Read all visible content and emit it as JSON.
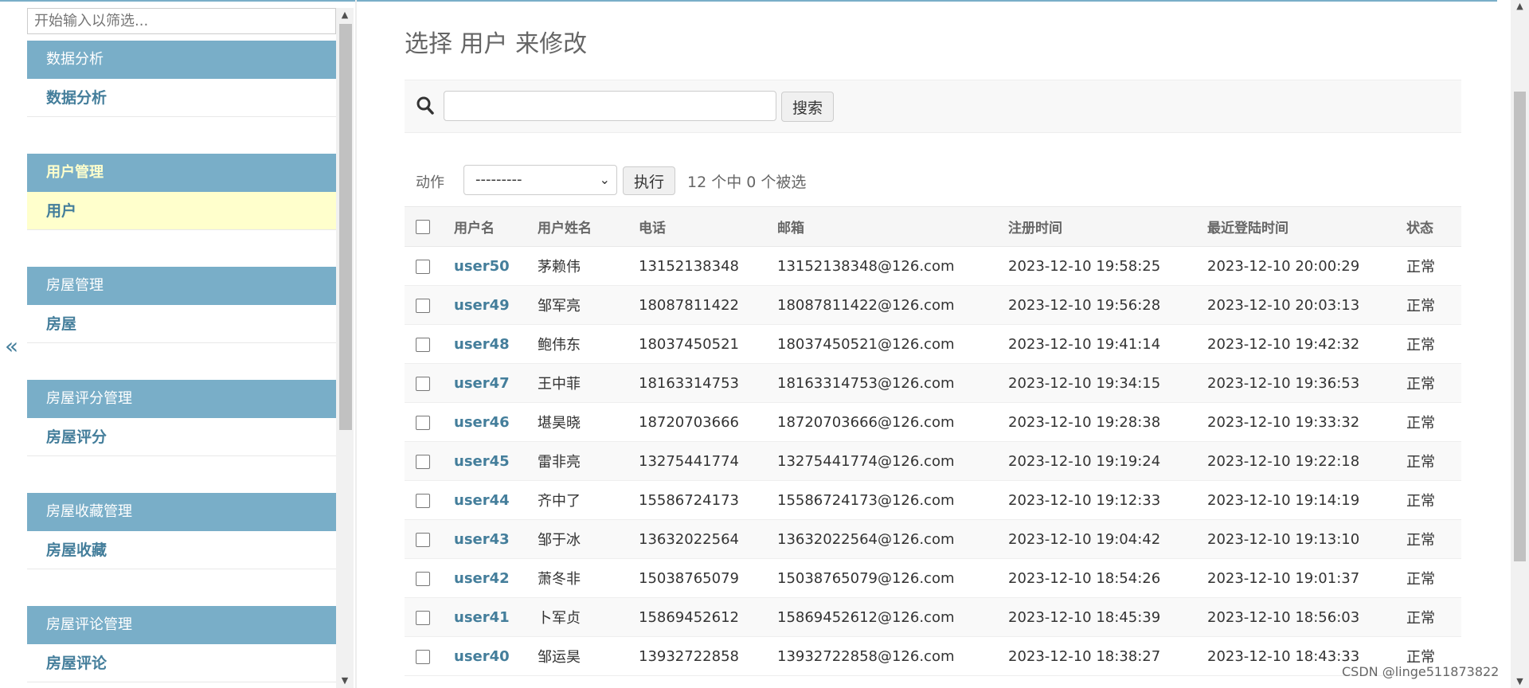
{
  "sidebar": {
    "filter_placeholder": "开始输入以筛选...",
    "sections": [
      {
        "caption": "数据分析",
        "model": "数据分析"
      },
      {
        "caption": "用户管理",
        "model": "用户"
      },
      {
        "caption": "房屋管理",
        "model": "房屋"
      },
      {
        "caption": "房屋评分管理",
        "model": "房屋评分"
      },
      {
        "caption": "房屋收藏管理",
        "model": "房屋收藏"
      },
      {
        "caption": "房屋评论管理",
        "model": "房屋评论"
      }
    ],
    "collapse_glyph": "«"
  },
  "page": {
    "title": "选择 用户 来修改",
    "search_button": "搜索",
    "actions_label": "动作",
    "actions_selected": "---------",
    "go_button": "执行",
    "selection_count": "12 个中 0 个被选"
  },
  "table": {
    "headers": [
      "用户名",
      "用户姓名",
      "电话",
      "邮箱",
      "注册时间",
      "最近登陆时间",
      "状态"
    ],
    "rows": [
      [
        "user50",
        "茅赖伟",
        "13152138348",
        "13152138348@126.com",
        "2023-12-10 19:58:25",
        "2023-12-10 20:00:29",
        "正常"
      ],
      [
        "user49",
        "邹军亮",
        "18087811422",
        "18087811422@126.com",
        "2023-12-10 19:56:28",
        "2023-12-10 20:03:13",
        "正常"
      ],
      [
        "user48",
        "鲍伟东",
        "18037450521",
        "18037450521@126.com",
        "2023-12-10 19:41:14",
        "2023-12-10 19:42:32",
        "正常"
      ],
      [
        "user47",
        "王中菲",
        "18163314753",
        "18163314753@126.com",
        "2023-12-10 19:34:15",
        "2023-12-10 19:36:53",
        "正常"
      ],
      [
        "user46",
        "堪昊晓",
        "18720703666",
        "18720703666@126.com",
        "2023-12-10 19:28:38",
        "2023-12-10 19:33:32",
        "正常"
      ],
      [
        "user45",
        "雷非亮",
        "13275441774",
        "13275441774@126.com",
        "2023-12-10 19:19:24",
        "2023-12-10 19:22:18",
        "正常"
      ],
      [
        "user44",
        "齐中了",
        "15586724173",
        "15586724173@126.com",
        "2023-12-10 19:12:33",
        "2023-12-10 19:14:19",
        "正常"
      ],
      [
        "user43",
        "邹于冰",
        "13632022564",
        "13632022564@126.com",
        "2023-12-10 19:04:42",
        "2023-12-10 19:13:10",
        "正常"
      ],
      [
        "user42",
        "萧冬非",
        "15038765079",
        "15038765079@126.com",
        "2023-12-10 18:54:26",
        "2023-12-10 19:01:37",
        "正常"
      ],
      [
        "user41",
        "卜军贞",
        "15869452612",
        "15869452612@126.com",
        "2023-12-10 18:45:39",
        "2023-12-10 18:56:03",
        "正常"
      ],
      [
        "user40",
        "邹运昊",
        "13932722858",
        "13932722858@126.com",
        "2023-12-10 18:38:27",
        "2023-12-10 18:43:33",
        "正常"
      ]
    ]
  },
  "watermark": "CSDN @linge511873822",
  "colors": {
    "caption_bg": "#79aec8",
    "link": "#447e9b",
    "current_bg": "#ffffcc"
  }
}
